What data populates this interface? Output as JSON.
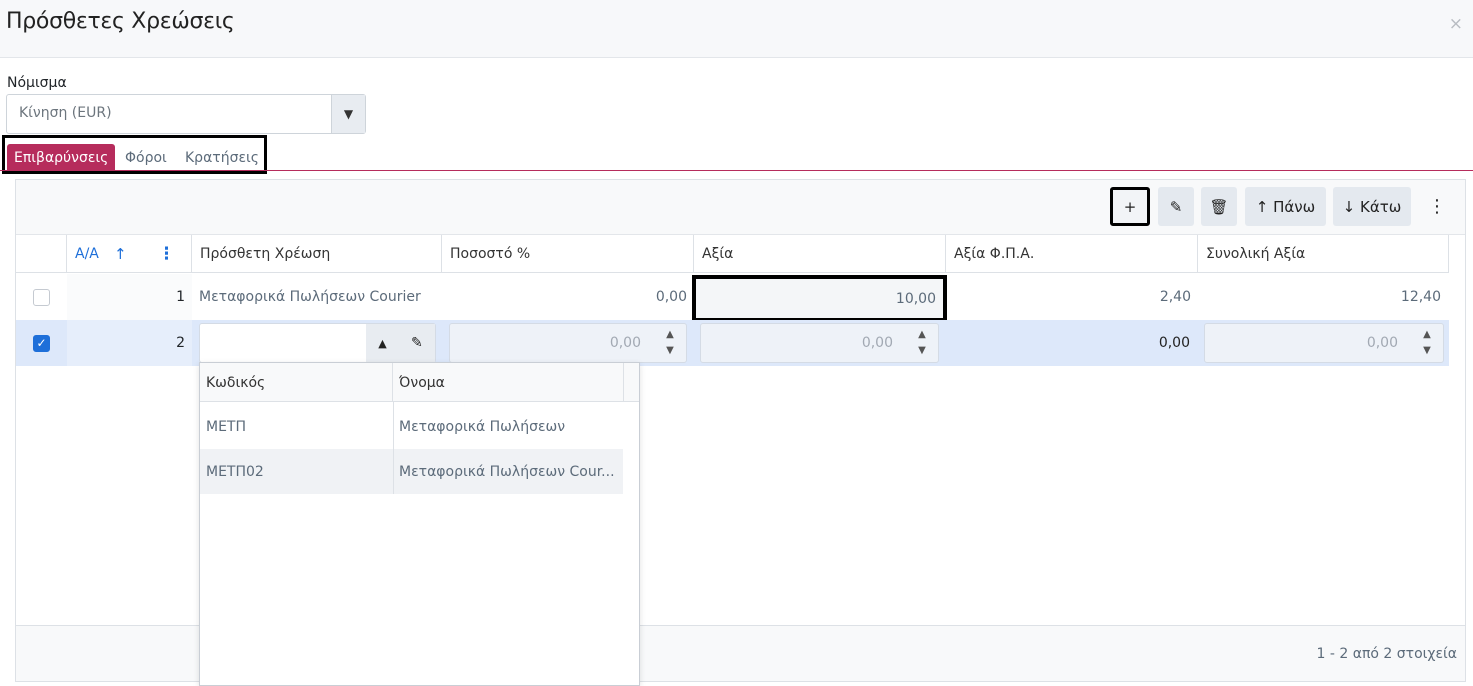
{
  "dialog": {
    "title": "Πρόσθετες Χρεώσεις",
    "close_icon": "×"
  },
  "currency": {
    "label": "Νόμισμα",
    "value": "Κίνηση (EUR)",
    "dropdown_icon": "▼"
  },
  "tabs": [
    {
      "label": "Επιβαρύνσεις",
      "active": true
    },
    {
      "label": "Φόροι",
      "active": false
    },
    {
      "label": "Κρατήσεις",
      "active": false
    }
  ],
  "toolbar": {
    "add": "+",
    "edit_icon": "✎",
    "delete_icon": "🗑",
    "up": "↑ Πάνω",
    "down": "↓ Κάτω",
    "more": "⋮"
  },
  "columns": {
    "index": "Α/Α",
    "index_sort": "↑",
    "index_menu": "⋮",
    "charge": "Πρόσθετη Χρέωση",
    "percent": "Ποσοστό %",
    "value": "Αξία",
    "vat": "Αξία Φ.Π.Α.",
    "total": "Συνολική Αξία"
  },
  "rows": [
    {
      "index": "1",
      "charge": "Μεταφορικά Πωλήσεων Courier",
      "percent": "0,00",
      "value": "10,00",
      "vat": "2,40",
      "total": "12,40",
      "checked": false
    },
    {
      "index": "2",
      "charge": "",
      "percent": "0,00",
      "value": "0,00",
      "vat": "0,00",
      "total": "0,00",
      "checked": true
    }
  ],
  "editor": {
    "spin_up": "▲",
    "spin_down": "▼",
    "combo_up": "▲",
    "combo_edit": "✎"
  },
  "lookup": {
    "columns": {
      "code": "Κωδικός",
      "name": "Όνομα"
    },
    "rows": [
      {
        "code": "ΜΕΤΠ",
        "name": "Μεταφορικά Πωλήσεων"
      },
      {
        "code": "ΜΕΤΠ02",
        "name": "Μεταφορικά Πωλήσεων Cour..."
      }
    ]
  },
  "pager": {
    "info": "1 - 2 από 2 στοιχεία"
  },
  "colors": {
    "accent": "#b62c5c",
    "link": "#1e6fd9",
    "selected_row": "#dde8fa"
  }
}
